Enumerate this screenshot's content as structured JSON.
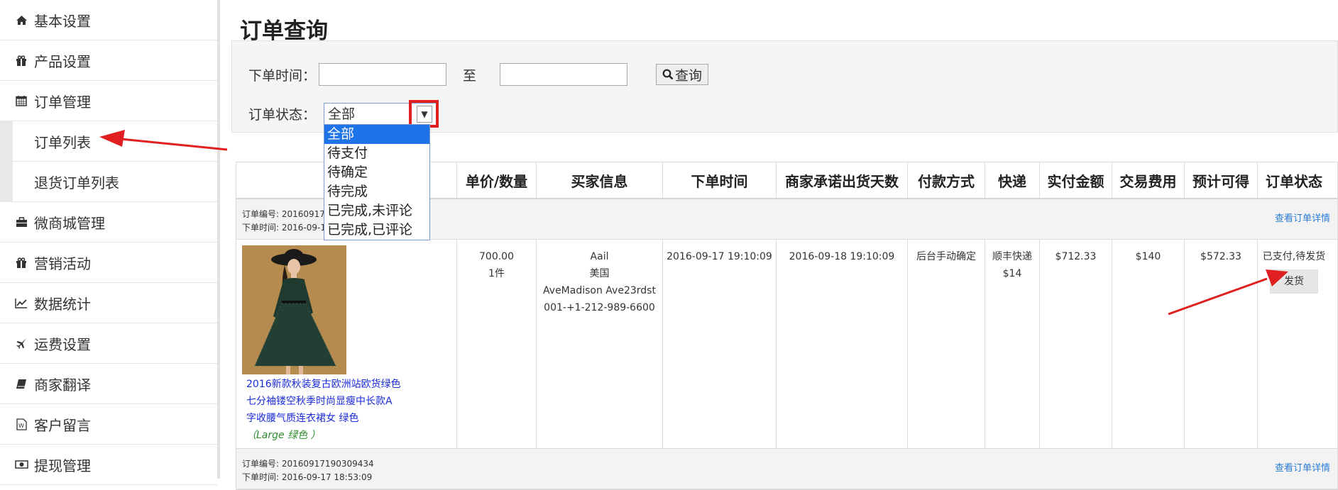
{
  "sidebar": {
    "items": [
      {
        "icon": "home-icon",
        "label": "基本设置"
      },
      {
        "icon": "gift-icon",
        "label": "产品设置"
      },
      {
        "icon": "calendar-icon",
        "label": "订单管理"
      },
      {
        "icon": "briefcase-icon",
        "label": "微商城管理"
      },
      {
        "icon": "gift-icon",
        "label": "营销活动"
      },
      {
        "icon": "line-chart-icon",
        "label": "数据统计"
      },
      {
        "icon": "plane-icon",
        "label": "运费设置"
      },
      {
        "icon": "book-icon",
        "label": "商家翻译"
      },
      {
        "icon": "word-doc-icon",
        "label": "客户留言"
      },
      {
        "icon": "money-icon",
        "label": "提现管理"
      }
    ],
    "subitems": [
      {
        "label": "订单列表"
      },
      {
        "label": "退货订单列表"
      }
    ]
  },
  "page": {
    "title": "订单查询"
  },
  "filters": {
    "order_time_label": "下单时间：",
    "to_label": "至",
    "query_button": "查询",
    "status_label": "订单状态：",
    "status_selected": "全部",
    "status_options": [
      "全部",
      "待支付",
      "待确定",
      "待完成",
      "已完成,未评论",
      "已完成,已评论"
    ]
  },
  "table": {
    "headers": [
      "",
      "单价/数量",
      "买家信息",
      "下单时间",
      "商家承诺出货天数",
      "付款方式",
      "快递",
      "实付金额",
      "交易费用",
      "预计可得",
      "订单状态"
    ],
    "orders": [
      {
        "meta_number": "订单编号: 2016091717",
        "meta_time": "下单时间: 2016-09-1",
        "detail_link": "查看订单详情",
        "product_name_lines": [
          "2016新款秋装复古欧洲站欧货绿色",
          "七分袖镂空秋季时尚显瘦中长款A",
          "字收腰气质连衣裙女 绿色"
        ],
        "product_variant": "（Large  绿色 ）",
        "price": "700.00",
        "quantity": "1件",
        "buyer_lines": [
          "Aail",
          "美国",
          "AveMadison Ave23rdst",
          "001-+1-212-989-6600"
        ],
        "order_time": "2016-09-17 19:10:09",
        "ship_deadline": "2016-09-18 19:10:09",
        "payment_method": "后台手动确定",
        "courier_lines": [
          "顺丰快递",
          "$14"
        ],
        "paid_amount": "$712.33",
        "fee": "$140",
        "expected": "$572.33",
        "status": "已支付,待发货",
        "ship_button": "发货"
      },
      {
        "meta_number": "订单编号: 20160917190309434",
        "meta_time": "下单时间: 2016-09-17 18:53:09",
        "detail_link": "查看订单详情"
      }
    ]
  },
  "colors": {
    "annotation_red": "#e02020",
    "link_blue": "#2b7bd6",
    "select_blue": "#1e73e8"
  }
}
